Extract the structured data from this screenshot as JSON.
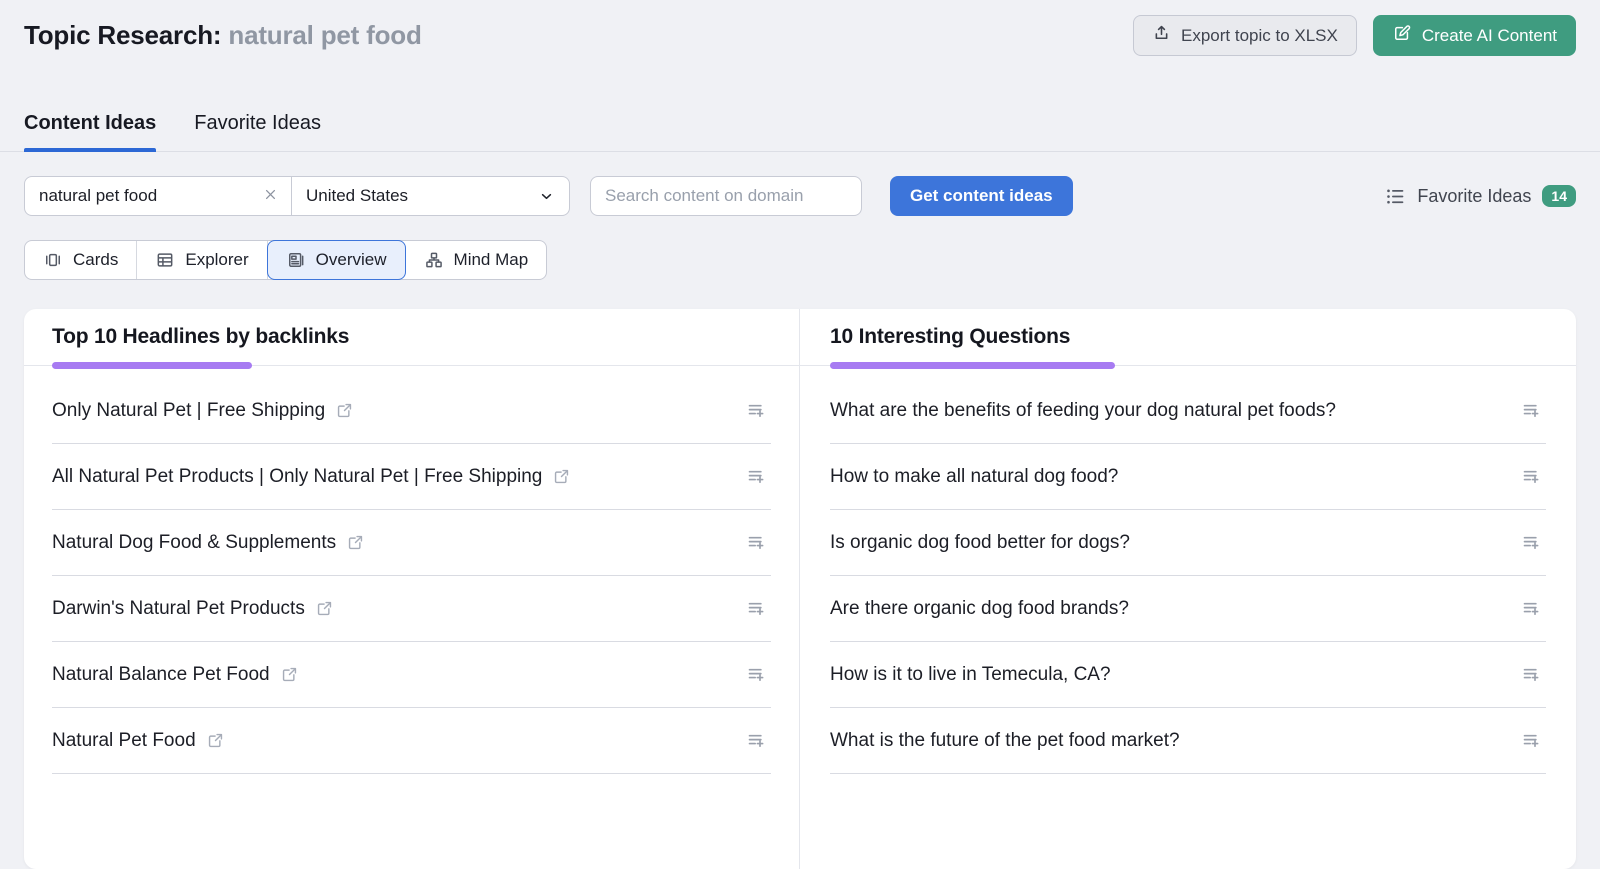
{
  "header": {
    "title_prefix": "Topic Research:",
    "title_topic": "natural pet food",
    "export_label": "Export topic to XLSX",
    "create_ai_label": "Create AI Content"
  },
  "tabs": [
    {
      "label": "Content Ideas",
      "active": true
    },
    {
      "label": "Favorite Ideas",
      "active": false
    }
  ],
  "filters": {
    "topic_value": "natural pet food",
    "country_value": "United States",
    "domain_placeholder": "Search content on domain",
    "submit_label": "Get content ideas",
    "favorites_label": "Favorite Ideas",
    "favorites_count": "14"
  },
  "views": [
    {
      "label": "Cards",
      "icon": "cards-icon",
      "selected": false
    },
    {
      "label": "Explorer",
      "icon": "table-icon",
      "selected": false
    },
    {
      "label": "Overview",
      "icon": "overview-icon",
      "selected": true
    },
    {
      "label": "Mind Map",
      "icon": "mindmap-icon",
      "selected": false
    }
  ],
  "panels": {
    "headlines": {
      "title": "Top 10 Headlines by backlinks",
      "external_link": true,
      "items": [
        "Only Natural Pet | Free Shipping",
        "All Natural Pet Products | Only Natural Pet | Free Shipping",
        "Natural Dog Food & Supplements",
        "Darwin's Natural Pet Products",
        "Natural Balance Pet Food",
        "Natural Pet Food"
      ]
    },
    "questions": {
      "title": "10 Interesting Questions",
      "external_link": false,
      "items": [
        "What are the benefits of feeding your dog natural pet foods?",
        "How to make all natural dog food?",
        "Is organic dog food better for dogs?",
        "Are there organic dog food brands?",
        "How is it to live in Temecula, CA?",
        "What is the future of the pet food market?"
      ]
    }
  },
  "colors": {
    "accent_blue": "#3d75da",
    "tab_underline": "#2c68d5",
    "brand_green": "#3f9c80",
    "accent_purple": "#a77bf2",
    "page_background": "#f0f1f5"
  }
}
